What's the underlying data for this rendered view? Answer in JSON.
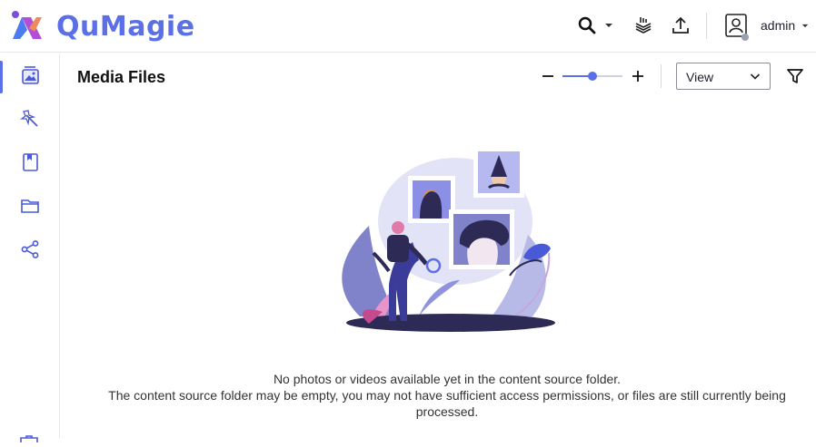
{
  "app": {
    "name": "QuMagie"
  },
  "header": {
    "icons": [
      "search-icon",
      "chevron-down-icon",
      "background-tasks-icon",
      "upload-icon",
      "user-avatar-icon"
    ],
    "user_name": "admin"
  },
  "sidebar": {
    "items": [
      {
        "id": "media-files",
        "icon": "photo-album-icon",
        "active": true
      },
      {
        "id": "smart-album",
        "icon": "magic-wand-icon",
        "active": false
      },
      {
        "id": "albums",
        "icon": "book-icon",
        "active": false
      },
      {
        "id": "folders",
        "icon": "folder-icon",
        "active": false
      },
      {
        "id": "share",
        "icon": "share-icon",
        "active": false
      }
    ]
  },
  "toolbar": {
    "title": "Media Files",
    "zoom_level": 0.5,
    "view_label": "View",
    "icons": [
      "zoom-out-icon",
      "zoom-in-icon",
      "filter-icon"
    ]
  },
  "empty_state": {
    "line1": "No photos or videos available yet in the content source folder.",
    "line2": "The content source folder may be empty, you may not have sufficient access permissions, or files are still currently being",
    "line3": "processed."
  },
  "colors": {
    "accent": "#5b6fe6",
    "illustration_dark": "#2d2b55",
    "illustration_light": "#dcdcf5"
  }
}
